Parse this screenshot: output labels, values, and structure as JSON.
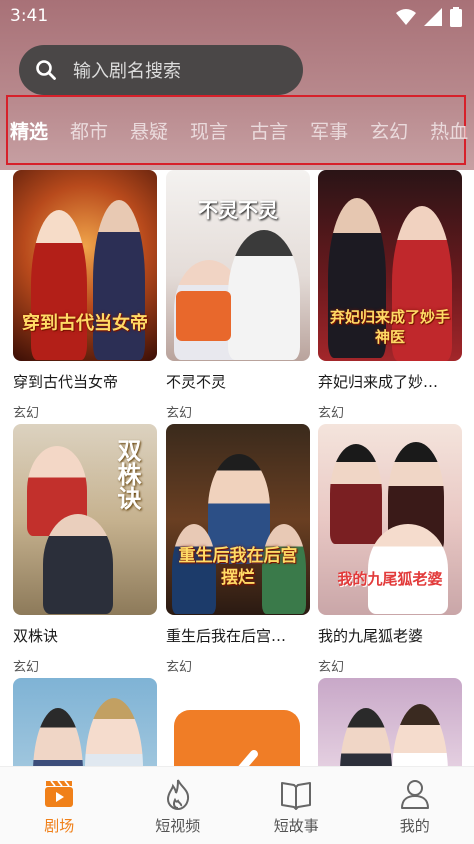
{
  "status_bar": {
    "time": "3:41"
  },
  "search": {
    "placeholder": "输入剧名搜索"
  },
  "tabs": [
    {
      "label": "精选",
      "active": true
    },
    {
      "label": "都市"
    },
    {
      "label": "悬疑"
    },
    {
      "label": "现言"
    },
    {
      "label": "古言"
    },
    {
      "label": "军事"
    },
    {
      "label": "玄幻"
    },
    {
      "label": "热血"
    }
  ],
  "dramas": [
    {
      "title": "穿到古代当女帝",
      "tag": "玄幻",
      "poster_text": "穿到古代当女帝"
    },
    {
      "title": "不灵不灵",
      "tag": "玄幻",
      "poster_text": "不灵不灵"
    },
    {
      "title": "弃妃归来成了妙…",
      "tag": "玄幻",
      "poster_text": "弃妃归来成了妙手神医"
    },
    {
      "title": "双株诀",
      "tag": "玄幻",
      "poster_text": "双株诀"
    },
    {
      "title": "重生后我在后宫…",
      "tag": "玄幻",
      "poster_text": "重生后我在后宫摆烂"
    },
    {
      "title": "我的九尾狐老婆",
      "tag": "玄幻",
      "poster_text": "我的九尾狐老婆"
    }
  ],
  "bottom_nav": [
    {
      "label": "剧场",
      "active": true
    },
    {
      "label": "短视频"
    },
    {
      "label": "短故事"
    },
    {
      "label": "我的"
    }
  ],
  "colors": {
    "accent": "#f08019",
    "header_bg": "#a87177",
    "highlight_box": "#d7202a"
  }
}
